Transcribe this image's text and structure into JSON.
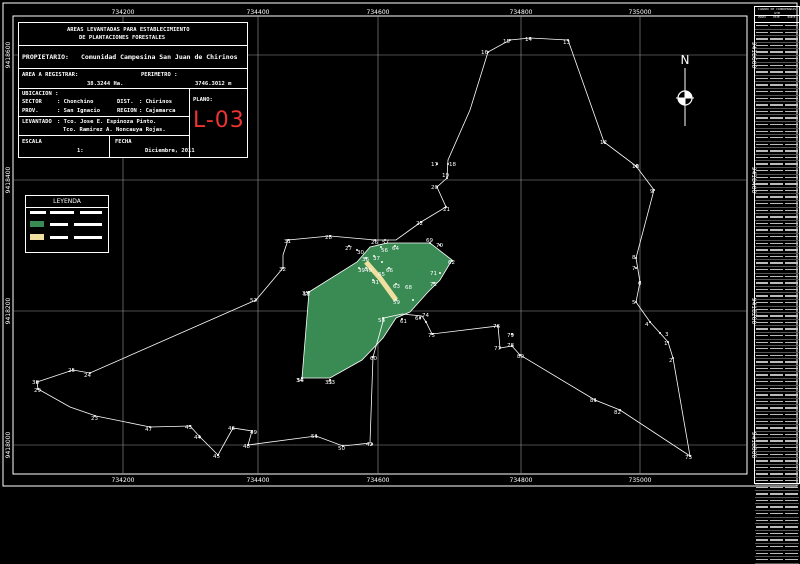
{
  "title_block": {
    "heading_line1": "AREAS LEVANTADAS PARA ESTABLECIMIENTO",
    "heading_line2": "DE PLANTACIONES FORESTALES",
    "owner_label": "PROPIETARIO:",
    "owner_value": "Comunidad Campesina San Juan de Chirinos",
    "area_label": "AREA A REGISTRAR:",
    "area_value": "38.3244 Ha.",
    "perimeter_label": "PERIMETRO :",
    "perimeter_value": "3746.3012 m",
    "location_label": "UBICACION :",
    "sector_label": "SECTOR",
    "sector_value": ": Chonchino",
    "district_label": "DIST.",
    "district_value": ": Chirinos",
    "plan_label": "PLANO:",
    "province_label": "PROV.",
    "province_value": ": San Ignacio",
    "region_label": "REGION",
    "region_value": ": Cajamarca",
    "surveyed_label": "LEVANTADO",
    "surveyed_line1": ": Tco. Jose E. Espinoza Pinto.",
    "surveyed_line2": "Tco. Ramirez A. Noncauya Rojas.",
    "scale_label": "ESCALA",
    "scale_value": "1:",
    "date_label": "FECHA",
    "date_value": "Diciembre, 2011"
  },
  "map_code": "L-03",
  "legend": {
    "title": "LEYENDA",
    "area_color": "#3a8a54",
    "trail_color": "#f0e0a0"
  },
  "north": {
    "label": "N"
  },
  "grid_labels": {
    "top": [
      "734200",
      "734400",
      "734600",
      "734800",
      "735000"
    ],
    "bottom": [
      "734200",
      "734400",
      "734600",
      "734800",
      "735000"
    ],
    "left": [
      "9418600",
      "9418400",
      "9418200",
      "9418000"
    ],
    "right": [
      "9418600",
      "9418400",
      "9418200",
      "9418000"
    ]
  },
  "table": {
    "title": "CUADRO DE COORDENADAS UTM",
    "col1": "PUNTO",
    "col2": "ESTE",
    "col3": "NORTE"
  },
  "boundary_points": [
    "13",
    "14",
    "15",
    "16",
    "17",
    "18",
    "19",
    "20",
    "21",
    "22",
    "23",
    "24",
    "25",
    "26",
    "27",
    "28",
    "29",
    "30",
    "31",
    "32",
    "33",
    "34",
    "35",
    "36",
    "37",
    "38",
    "39",
    "40",
    "41",
    "42",
    "43",
    "44",
    "45",
    "46",
    "47",
    "48",
    "49",
    "50",
    "51",
    "52",
    "53",
    "54",
    "55",
    "56",
    "57",
    "58",
    "59",
    "60",
    "61",
    "62",
    "63",
    "64",
    "65",
    "66",
    "67",
    "68",
    "69",
    "70",
    "71",
    "72",
    "73",
    "74",
    "75",
    "76",
    "77",
    "78",
    "79",
    "80",
    "81",
    "82",
    "1",
    "2",
    "3",
    "4",
    "5",
    "6",
    "7",
    "8",
    "9",
    "10",
    "11",
    "12"
  ],
  "colors": {
    "boundary": "#ffffff",
    "area_fill": "#3a8a54",
    "grid": "#9a9a9a",
    "map_code": "#e33333"
  }
}
